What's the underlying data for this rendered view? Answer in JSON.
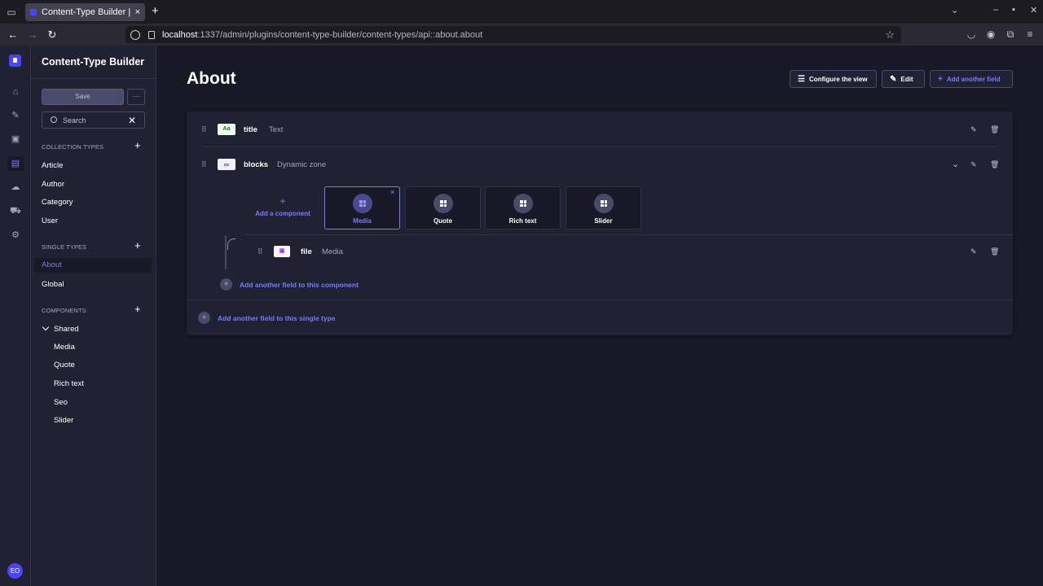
{
  "browser": {
    "tab_title": "Content-Type Builder | S",
    "tab_close": "×",
    "new_tab": "+",
    "url_host": "localhost",
    "url_path": ":1337/admin/plugins/content-type-builder/content-types/api::about.about"
  },
  "sidebar": {
    "title": "Content-Type Builder",
    "save_label": "Save",
    "more_label": "···",
    "search_placeholder": "Search",
    "collection_types": {
      "heading": "COLLECTION TYPES",
      "items": [
        "Article",
        "Author",
        "Category",
        "User"
      ]
    },
    "single_types": {
      "heading": "SINGLE TYPES",
      "items": [
        "About",
        "Global"
      ],
      "active": "About"
    },
    "components": {
      "heading": "COMPONENTS",
      "group": "Shared",
      "items": [
        "Media",
        "Quote",
        "Rich text",
        "Seo",
        "Slider"
      ]
    }
  },
  "user": {
    "initials": "EO"
  },
  "header": {
    "title": "About",
    "configure_label": "Configure the view",
    "edit_label": "Edit",
    "add_field_label": "Add another field"
  },
  "fields": {
    "title": {
      "name": "title",
      "type": "Text",
      "icon": "Aa"
    },
    "blocks": {
      "name": "blocks",
      "type": "Dynamic zone",
      "icon": "∞"
    },
    "file": {
      "name": "file",
      "type": "Media"
    }
  },
  "dynamic_zone": {
    "add_component_label": "Add a component",
    "components": [
      "Media",
      "Quote",
      "Rich text",
      "Slider"
    ],
    "active_component": "Media",
    "add_to_component_label": "Add another field to this component"
  },
  "footer": {
    "add_to_single_type_label": "Add another field to this single type"
  },
  "colors": {
    "accent": "#7b79ff",
    "primary": "#4945ff",
    "bg": "#181826",
    "panel": "#212134"
  }
}
